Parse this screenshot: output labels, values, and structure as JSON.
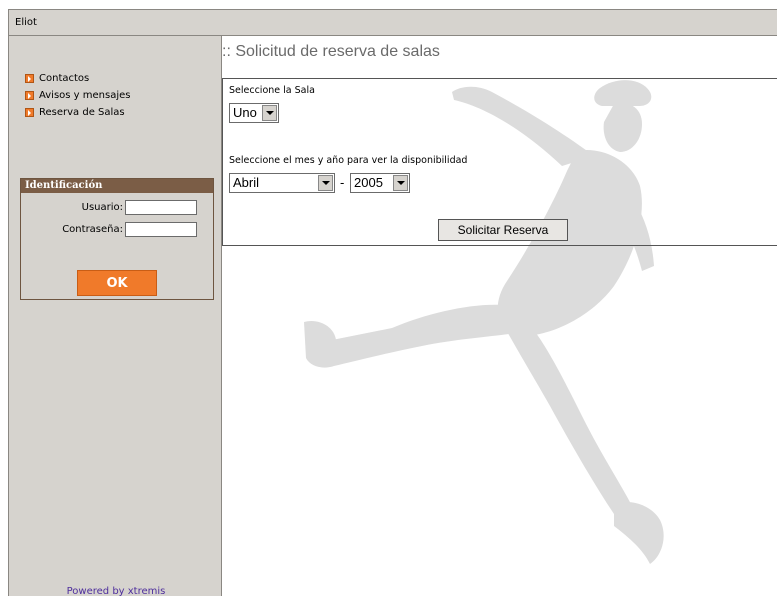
{
  "app": {
    "title": "Eliot"
  },
  "sidebar": {
    "menu": [
      {
        "label": "Contactos"
      },
      {
        "label": "Avisos y mensajes"
      },
      {
        "label": "Reserva de Salas"
      }
    ],
    "login": {
      "header": "Identificación",
      "user_label": "Usuario:",
      "user_value": "",
      "password_label": "Contraseña:",
      "password_value": "",
      "ok_label": "OK"
    },
    "footer": "Powered by xtremis"
  },
  "main": {
    "title": ":: Solicitud de reserva de salas",
    "room_label": "Seleccione la Sala",
    "room_value": "Uno",
    "period_label": "Seleccione el mes y año para ver la disponibilidad",
    "month_value": "Abril",
    "separator": "-",
    "year_value": "2005",
    "submit_label": "Solicitar Reserva"
  },
  "colors": {
    "accent": "#f07a2a",
    "sidebar_bg": "#d6d3ce",
    "login_header": "#7b5d46"
  }
}
